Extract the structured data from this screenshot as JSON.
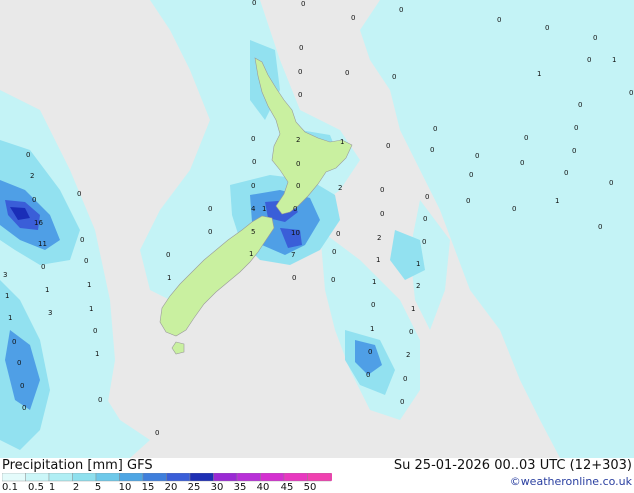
{
  "map": {
    "region": "New Zealand",
    "colors": {
      "background": "#e9e9e9",
      "land": "#c9f0a0",
      "precip_light": "#b9f2f5",
      "precip_medium": "#7fd6ee",
      "precip_heavy": "#4a9ee6",
      "precip_very_heavy": "#3a5ed8",
      "precip_extreme": "#1a2eb8"
    },
    "values": [
      "0",
      "0",
      "0",
      "0",
      "0",
      "0",
      "0",
      "1",
      "0",
      "0",
      "0",
      "1",
      "0",
      "0",
      "0",
      "0",
      "0",
      "0",
      "0",
      "0",
      "0",
      "2",
      "0",
      "1",
      "0",
      "0",
      "0",
      "0",
      "2",
      "0",
      "0",
      "0",
      "0",
      "0",
      "0",
      "0",
      "0",
      "0",
      "0",
      "2",
      "0",
      "1",
      "0",
      "0",
      "16",
      "0",
      "0",
      "4",
      "1",
      "0",
      "5",
      "10",
      "0",
      "3",
      "0",
      "0",
      "11",
      "0",
      "2",
      "0",
      "0",
      "0",
      "7",
      "1",
      "0",
      "1",
      "0",
      "0",
      "1",
      "0",
      "1",
      "1",
      "1",
      "0",
      "1",
      "0",
      "2",
      "1",
      "1",
      "3",
      "1",
      "1",
      "0",
      "0",
      "1",
      "0",
      "0",
      "0",
      "1",
      "0",
      "2",
      "0",
      "0",
      "0",
      "0",
      "0",
      "0",
      "0"
    ]
  },
  "footer": {
    "title": "Precipitation [mm] GFS",
    "timestamp": "Su 25-01-2026 00..03 UTC (12+303)",
    "credit": "©weatheronline.co.uk",
    "scale_labels": [
      "0.1",
      "0.5",
      "1",
      "2",
      "5",
      "10",
      "15",
      "20",
      "25",
      "30",
      "35",
      "40",
      "45",
      "50"
    ],
    "scale_colors": [
      "#e4fbfb",
      "#cbf6f8",
      "#b0eef4",
      "#8fe0ee",
      "#6ec9ea",
      "#4ea6e4",
      "#3f7fdc",
      "#3a5ed8",
      "#1e2fb4",
      "#9a2ad4",
      "#b830d8",
      "#d430d0",
      "#e838c0",
      "#f040b0"
    ]
  }
}
